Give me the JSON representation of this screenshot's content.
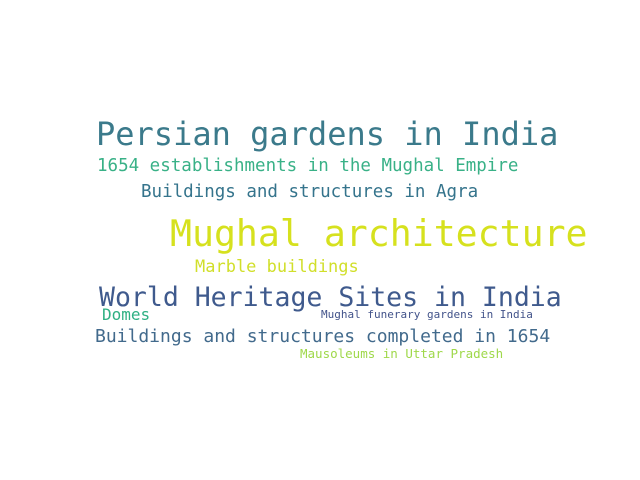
{
  "word_cloud": {
    "words": [
      {
        "text": "Persian gardens in India",
        "color": "#3b7a8b"
      },
      {
        "text": "1654 establishments in the Mughal Empire",
        "color": "#39b187"
      },
      {
        "text": "Buildings and structures in Agra",
        "color": "#35748c"
      },
      {
        "text": "Mughal architecture",
        "color": "#d6e11e"
      },
      {
        "text": "Marble buildings",
        "color": "#d1df2a"
      },
      {
        "text": "World Heritage Sites in India",
        "color": "#3f5a8d"
      },
      {
        "text": "Domes",
        "color": "#2fb083"
      },
      {
        "text": "Mughal funerary gardens in India",
        "color": "#42538a"
      },
      {
        "text": "Buildings and structures completed in 1654",
        "color": "#426a8c"
      },
      {
        "text": "Mausoleums in Uttar Pradesh",
        "color": "#9fd84a"
      }
    ]
  }
}
